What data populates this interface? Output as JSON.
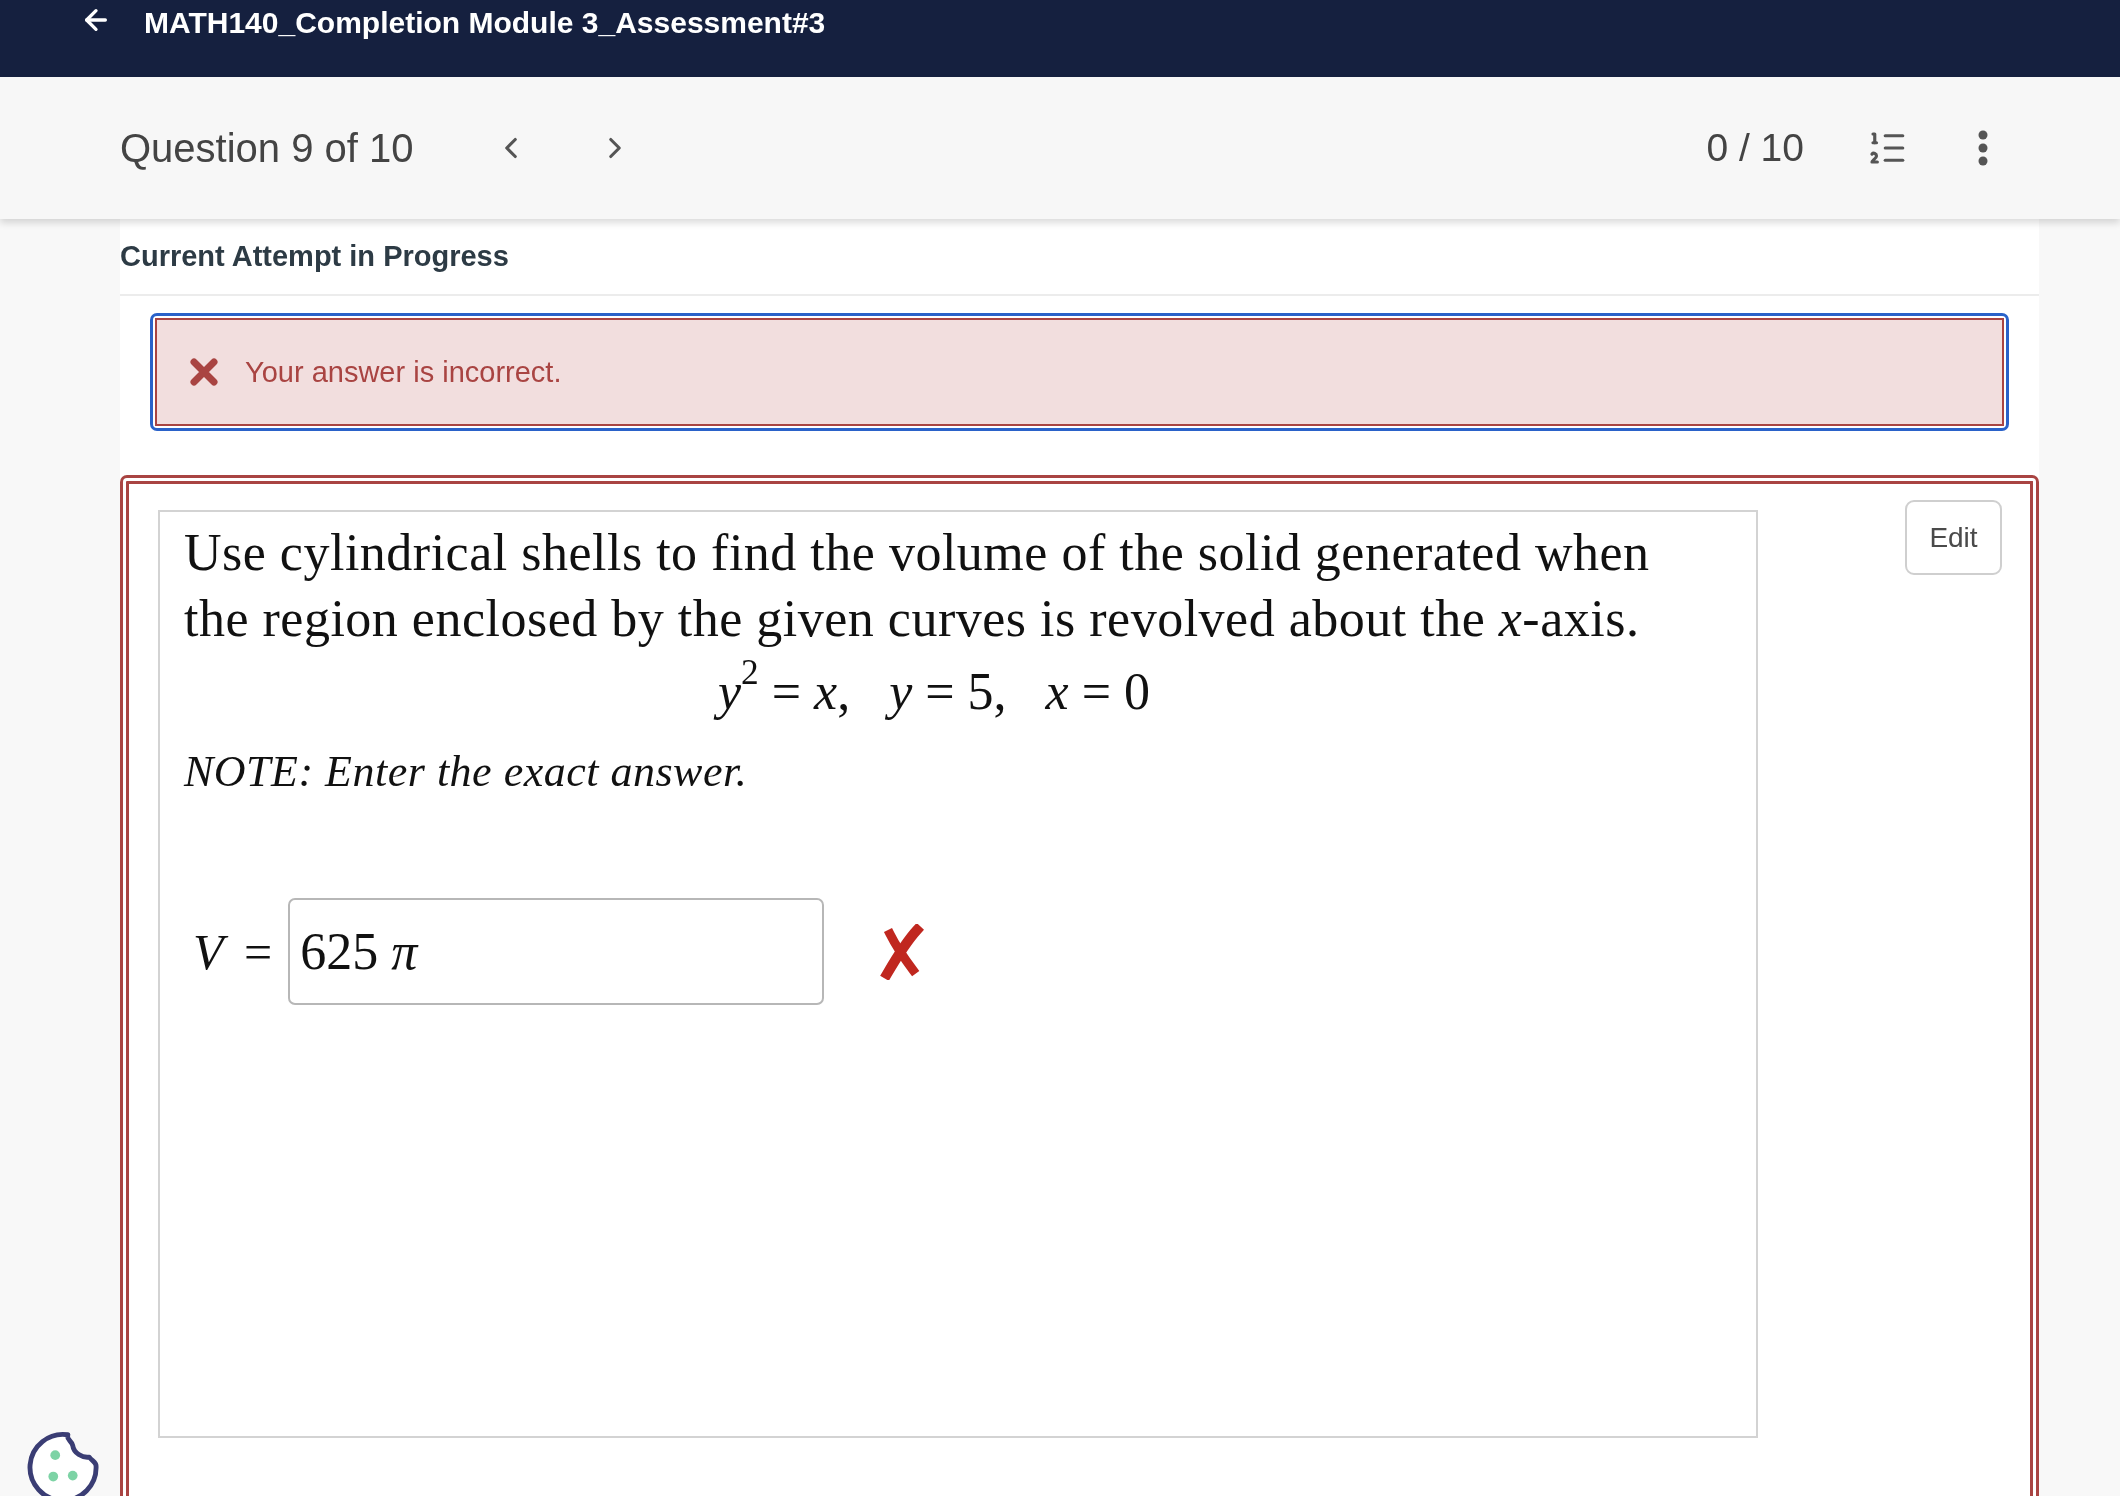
{
  "header": {
    "title": "MATH140_Completion Module 3_Assessment#3"
  },
  "question_nav": {
    "position": "Question 9 of 10",
    "score": "0 / 10"
  },
  "attempt_status": "Current Attempt in Progress",
  "feedback": {
    "kind": "incorrect",
    "message": "Your answer is incorrect."
  },
  "question": {
    "prompt": "Use cylindrical shells to find the volume of the solid generated when the region enclosed by the given curves is revolved about the *x*-axis.",
    "equation": "*y*$^{2}$ = *x*,   *y* = 5,   *x* = 0",
    "note": "NOTE: Enter the exact answer.",
    "answer_label": "*V* =",
    "answer_value": "625 *π*",
    "answer_correct": false,
    "edit_button": "Edit"
  }
}
